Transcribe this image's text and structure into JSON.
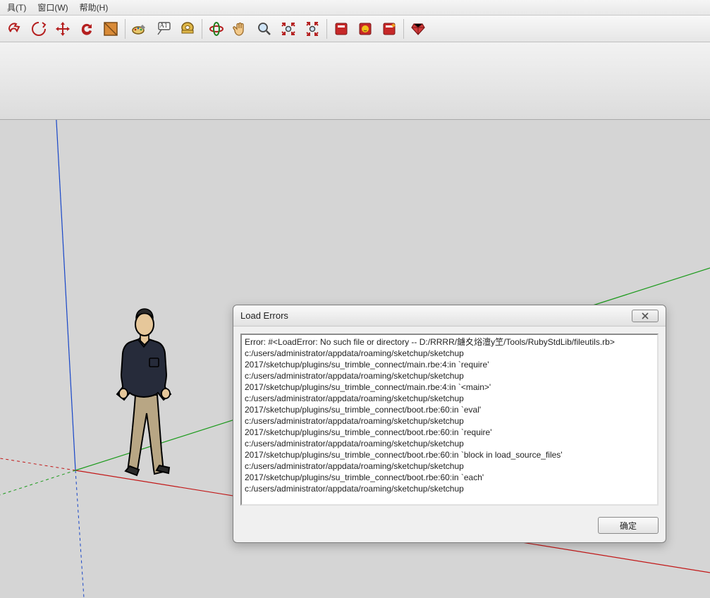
{
  "menubar": {
    "items": [
      {
        "label": "具(T)"
      },
      {
        "label": "窗口(W)"
      },
      {
        "label": "帮助(H)"
      }
    ]
  },
  "toolbar": {
    "groups": [
      [
        "select-icon",
        "rotate3d-icon",
        "move-icon",
        "refresh-icon",
        "plane-icon"
      ],
      [
        "paint-icon",
        "text-label-icon",
        "tape-icon"
      ],
      [
        "orbit-icon",
        "hand-icon",
        "zoom-icon",
        "zoom-extents-icon",
        "zoom-window-icon"
      ],
      [
        "book-red-icon",
        "book-smile-icon",
        "book-new-icon"
      ],
      [
        "ruby-icon"
      ]
    ]
  },
  "dialog": {
    "title": "Load Errors",
    "ok_label": "确定",
    "error_text": "Error: #<LoadError: No such file or directory -- D:/RRRR/鐪夊焀澶y笁/Tools/RubyStdLib/fileutils.rb>\nc:/users/administrator/appdata/roaming/sketchup/sketchup 2017/sketchup/plugins/su_trimble_connect/main.rbe:4:in `require'\nc:/users/administrator/appdata/roaming/sketchup/sketchup 2017/sketchup/plugins/su_trimble_connect/main.rbe:4:in `<main>'\nc:/users/administrator/appdata/roaming/sketchup/sketchup 2017/sketchup/plugins/su_trimble_connect/boot.rbe:60:in `eval'\nc:/users/administrator/appdata/roaming/sketchup/sketchup 2017/sketchup/plugins/su_trimble_connect/boot.rbe:60:in `require'\nc:/users/administrator/appdata/roaming/sketchup/sketchup 2017/sketchup/plugins/su_trimble_connect/boot.rbe:60:in `block in load_source_files'\nc:/users/administrator/appdata/roaming/sketchup/sketchup 2017/sketchup/plugins/su_trimble_connect/boot.rbe:60:in `each'\nc:/users/administrator/appdata/roaming/sketchup/sketchup"
  },
  "toolbar_labels": {
    "text_label_badge": "A1"
  }
}
